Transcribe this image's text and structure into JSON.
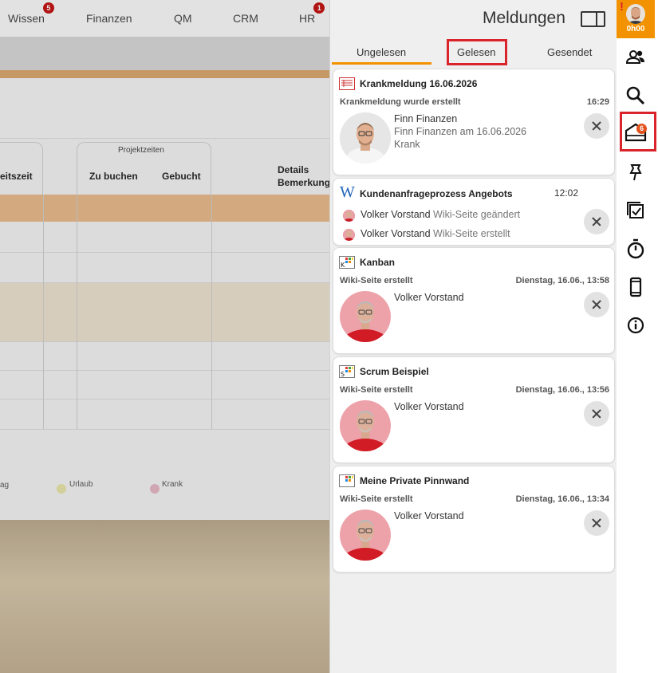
{
  "background": {
    "nav": [
      {
        "label": "Wissen",
        "badge": "5"
      },
      {
        "label": "Finanzen"
      },
      {
        "label": "QM"
      },
      {
        "label": "CRM"
      },
      {
        "label": "HR",
        "badge": "1"
      }
    ],
    "table": {
      "col_partial": "eitszeit",
      "group_label": "Projektzeiten",
      "col_zu_buchen": "Zu buchen",
      "col_gebucht": "Gebucht",
      "col_details_1": "Details",
      "col_details_2": "Bemerkung"
    },
    "legend": [
      {
        "label": "ag",
        "color": ""
      },
      {
        "label": "Urlaub",
        "color": "#e8e5a6"
      },
      {
        "label": "Krank",
        "color": "#e6b6c4"
      }
    ]
  },
  "panel": {
    "title": "Meldungen",
    "tabs": [
      {
        "label": "Ungelesen",
        "active": true
      },
      {
        "label": "Gelesen",
        "highlighted": true
      },
      {
        "label": "Gesendet"
      }
    ],
    "cards": [
      {
        "icon": "sick-note-icon",
        "title": "Krankmeldung 16.06.2026",
        "subtitle": "Krankmeldung wurde erstellt",
        "time": "16:29",
        "person": "Finn Finanzen",
        "line2": "Finn Finanzen am 16.06.2026",
        "line3": "Krank"
      },
      {
        "icon": "wiki-icon",
        "title": "Kundenanfrageprozess Angebots",
        "time": "12:02",
        "entries": [
          {
            "name": "Volker Vorstand",
            "action": "Wiki-Seite geändert"
          },
          {
            "name": "Volker Vorstand",
            "action": "Wiki-Seite erstellt"
          }
        ]
      },
      {
        "icon": "kanban-icon",
        "icon_letter": "K",
        "title": "Kanban",
        "subtitle": "Wiki-Seite erstellt",
        "time": "Dienstag, 16.06., 13:58",
        "person": "Volker Vorstand"
      },
      {
        "icon": "scrum-icon",
        "icon_letter": "S",
        "title": "Scrum Beispiel",
        "subtitle": "Wiki-Seite erstellt",
        "time": "Dienstag, 16.06., 13:56",
        "person": "Volker Vorstand"
      },
      {
        "icon": "pinboard-icon",
        "icon_letter": "",
        "title": "Meine Private Pinnwand",
        "subtitle": "Wiki-Seite erstellt",
        "time": "Dienstag, 16.06., 13:34",
        "person": "Volker Vorstand"
      }
    ]
  },
  "toolbar": {
    "user_time": "0h00",
    "user_alert": "!",
    "notification_badge": "6",
    "buttons": [
      "users-icon",
      "search-icon",
      "notifications-icon",
      "pin-icon",
      "tasks-icon",
      "timer-icon",
      "mobile-icon",
      "info-icon"
    ]
  },
  "colors": {
    "accent": "#f39200",
    "highlight": "#d9242c",
    "badge": "#c20d0d"
  }
}
